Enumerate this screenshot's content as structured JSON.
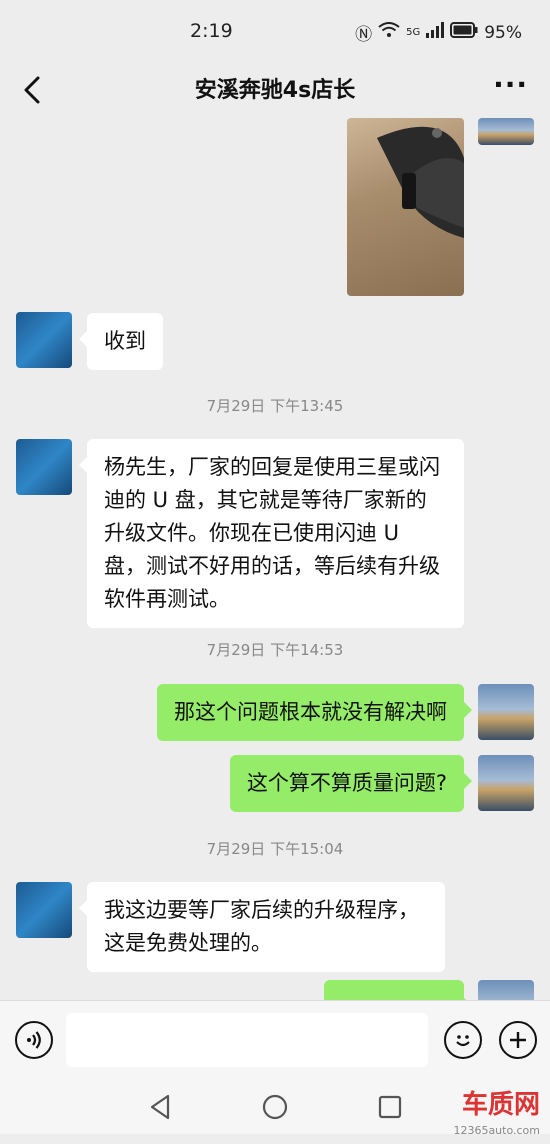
{
  "status_bar": {
    "time": "2:19",
    "network": "5G",
    "battery": "95%"
  },
  "header": {
    "title": "安溪奔驰4s店长",
    "more_label": "···"
  },
  "messages": {
    "m1": "收到",
    "ts1": "7月29日 下午13:45",
    "m2": "杨先生，厂家的回复是使用三星或闪迪的 U 盘，其它就是等待厂家新的升级文件。你现在已使用闪迪 U 盘，测试不好用的话，等后续有升级软件再测试。",
    "ts2": "7月29日 下午14:53",
    "m3": "那这个问题根本就没有解决啊",
    "m4": "这个算不算质量问题?",
    "ts3": "7月29日 下午15:04",
    "m5": "我这边要等厂家后续的升级程序，这是免费处理的。"
  },
  "input": {
    "placeholder": ""
  },
  "watermark": {
    "brand": "车质网",
    "url": "12365auto.com"
  },
  "colors": {
    "my_bubble": "#95ec69",
    "their_bubble": "#ffffff",
    "background": "#ededed"
  }
}
